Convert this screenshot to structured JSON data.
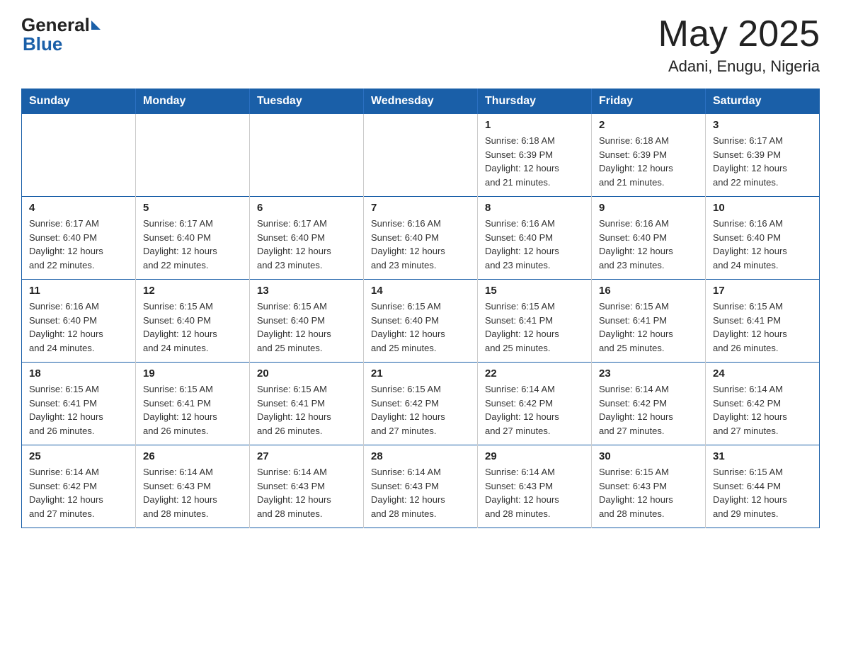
{
  "header": {
    "logo_general": "General",
    "logo_blue": "Blue",
    "title": "May 2025",
    "location": "Adani, Enugu, Nigeria"
  },
  "weekdays": [
    "Sunday",
    "Monday",
    "Tuesday",
    "Wednesday",
    "Thursday",
    "Friday",
    "Saturday"
  ],
  "weeks": [
    [
      {
        "day": "",
        "info": ""
      },
      {
        "day": "",
        "info": ""
      },
      {
        "day": "",
        "info": ""
      },
      {
        "day": "",
        "info": ""
      },
      {
        "day": "1",
        "info": "Sunrise: 6:18 AM\nSunset: 6:39 PM\nDaylight: 12 hours\nand 21 minutes."
      },
      {
        "day": "2",
        "info": "Sunrise: 6:18 AM\nSunset: 6:39 PM\nDaylight: 12 hours\nand 21 minutes."
      },
      {
        "day": "3",
        "info": "Sunrise: 6:17 AM\nSunset: 6:39 PM\nDaylight: 12 hours\nand 22 minutes."
      }
    ],
    [
      {
        "day": "4",
        "info": "Sunrise: 6:17 AM\nSunset: 6:40 PM\nDaylight: 12 hours\nand 22 minutes."
      },
      {
        "day": "5",
        "info": "Sunrise: 6:17 AM\nSunset: 6:40 PM\nDaylight: 12 hours\nand 22 minutes."
      },
      {
        "day": "6",
        "info": "Sunrise: 6:17 AM\nSunset: 6:40 PM\nDaylight: 12 hours\nand 23 minutes."
      },
      {
        "day": "7",
        "info": "Sunrise: 6:16 AM\nSunset: 6:40 PM\nDaylight: 12 hours\nand 23 minutes."
      },
      {
        "day": "8",
        "info": "Sunrise: 6:16 AM\nSunset: 6:40 PM\nDaylight: 12 hours\nand 23 minutes."
      },
      {
        "day": "9",
        "info": "Sunrise: 6:16 AM\nSunset: 6:40 PM\nDaylight: 12 hours\nand 23 minutes."
      },
      {
        "day": "10",
        "info": "Sunrise: 6:16 AM\nSunset: 6:40 PM\nDaylight: 12 hours\nand 24 minutes."
      }
    ],
    [
      {
        "day": "11",
        "info": "Sunrise: 6:16 AM\nSunset: 6:40 PM\nDaylight: 12 hours\nand 24 minutes."
      },
      {
        "day": "12",
        "info": "Sunrise: 6:15 AM\nSunset: 6:40 PM\nDaylight: 12 hours\nand 24 minutes."
      },
      {
        "day": "13",
        "info": "Sunrise: 6:15 AM\nSunset: 6:40 PM\nDaylight: 12 hours\nand 25 minutes."
      },
      {
        "day": "14",
        "info": "Sunrise: 6:15 AM\nSunset: 6:40 PM\nDaylight: 12 hours\nand 25 minutes."
      },
      {
        "day": "15",
        "info": "Sunrise: 6:15 AM\nSunset: 6:41 PM\nDaylight: 12 hours\nand 25 minutes."
      },
      {
        "day": "16",
        "info": "Sunrise: 6:15 AM\nSunset: 6:41 PM\nDaylight: 12 hours\nand 25 minutes."
      },
      {
        "day": "17",
        "info": "Sunrise: 6:15 AM\nSunset: 6:41 PM\nDaylight: 12 hours\nand 26 minutes."
      }
    ],
    [
      {
        "day": "18",
        "info": "Sunrise: 6:15 AM\nSunset: 6:41 PM\nDaylight: 12 hours\nand 26 minutes."
      },
      {
        "day": "19",
        "info": "Sunrise: 6:15 AM\nSunset: 6:41 PM\nDaylight: 12 hours\nand 26 minutes."
      },
      {
        "day": "20",
        "info": "Sunrise: 6:15 AM\nSunset: 6:41 PM\nDaylight: 12 hours\nand 26 minutes."
      },
      {
        "day": "21",
        "info": "Sunrise: 6:15 AM\nSunset: 6:42 PM\nDaylight: 12 hours\nand 27 minutes."
      },
      {
        "day": "22",
        "info": "Sunrise: 6:14 AM\nSunset: 6:42 PM\nDaylight: 12 hours\nand 27 minutes."
      },
      {
        "day": "23",
        "info": "Sunrise: 6:14 AM\nSunset: 6:42 PM\nDaylight: 12 hours\nand 27 minutes."
      },
      {
        "day": "24",
        "info": "Sunrise: 6:14 AM\nSunset: 6:42 PM\nDaylight: 12 hours\nand 27 minutes."
      }
    ],
    [
      {
        "day": "25",
        "info": "Sunrise: 6:14 AM\nSunset: 6:42 PM\nDaylight: 12 hours\nand 27 minutes."
      },
      {
        "day": "26",
        "info": "Sunrise: 6:14 AM\nSunset: 6:43 PM\nDaylight: 12 hours\nand 28 minutes."
      },
      {
        "day": "27",
        "info": "Sunrise: 6:14 AM\nSunset: 6:43 PM\nDaylight: 12 hours\nand 28 minutes."
      },
      {
        "day": "28",
        "info": "Sunrise: 6:14 AM\nSunset: 6:43 PM\nDaylight: 12 hours\nand 28 minutes."
      },
      {
        "day": "29",
        "info": "Sunrise: 6:14 AM\nSunset: 6:43 PM\nDaylight: 12 hours\nand 28 minutes."
      },
      {
        "day": "30",
        "info": "Sunrise: 6:15 AM\nSunset: 6:43 PM\nDaylight: 12 hours\nand 28 minutes."
      },
      {
        "day": "31",
        "info": "Sunrise: 6:15 AM\nSunset: 6:44 PM\nDaylight: 12 hours\nand 29 minutes."
      }
    ]
  ]
}
